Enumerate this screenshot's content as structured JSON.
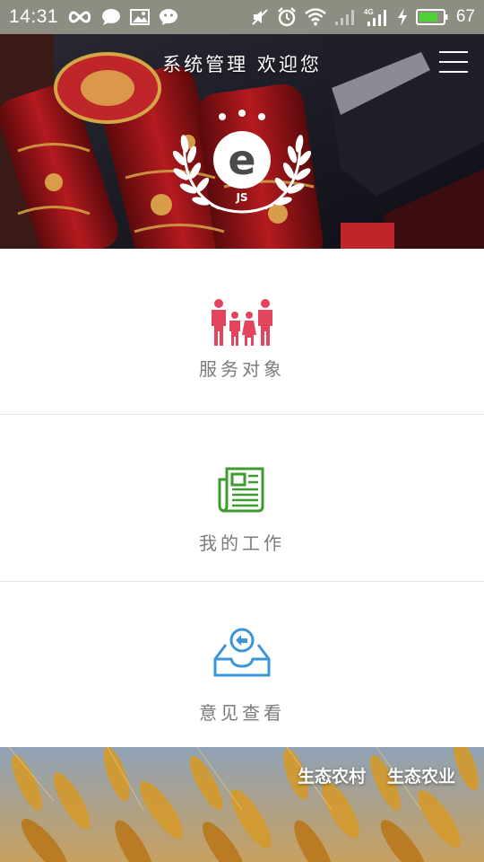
{
  "status_bar": {
    "time": "14:31",
    "battery_level": "67",
    "left_icons": [
      "infinity-icon",
      "message-bubble-icon",
      "image-icon",
      "wechat-icon"
    ],
    "right_icons": [
      "mute-icon",
      "alarm-icon",
      "wifi-icon",
      "signal-icon",
      "4g-signal-icon",
      "charging-icon",
      "battery-icon"
    ]
  },
  "header": {
    "title": "系统管理 欢迎您",
    "logo_letter": "e",
    "logo_initials": "JS"
  },
  "menu": {
    "items": [
      {
        "label": "服务对象",
        "icon": "family-icon",
        "color": "#e4455e"
      },
      {
        "label": "我的工作",
        "icon": "newspaper-icon",
        "color": "#3d9b2f"
      },
      {
        "label": "意见查看",
        "icon": "inbox-reply-icon",
        "color": "#3a96d8"
      }
    ]
  },
  "footer": {
    "links": [
      "生态农村",
      "生态农业"
    ]
  }
}
